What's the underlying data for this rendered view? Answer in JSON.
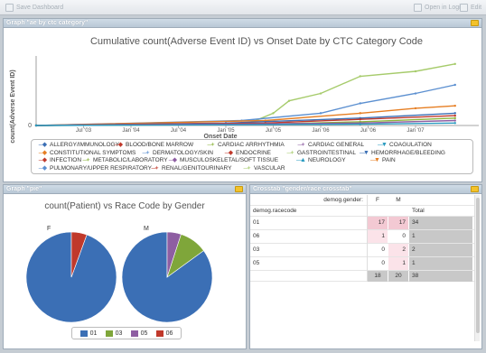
{
  "toolbar": {
    "save_dashboard": "Save Dashboard",
    "open_in_logic": "Open in Logic",
    "edit": "Edit"
  },
  "line_panel": {
    "title": "Graph \"ae by ctc category\"",
    "chart_title": "Cumulative count(Adverse Event ID) vs Onset Date by CTC Category Code",
    "ylabel": "count(Adverse Event ID)",
    "xlabel": "Onset Date"
  },
  "legend": [
    {
      "label": "ALLERGY/IMMUNOLOGY",
      "color": "#3b6fb5",
      "marker": "◆"
    },
    {
      "label": "BLOOD/BONE MARROW",
      "color": "#c0392b",
      "marker": "◆"
    },
    {
      "label": "CARDIAC ARRHYTHMIA",
      "color": "#8bb43a",
      "marker": "+"
    },
    {
      "label": "CARDIAC GENERAL",
      "color": "#8e5ea2",
      "marker": "+"
    },
    {
      "label": "COAGULATION",
      "color": "#2a9bc0",
      "marker": "▼"
    },
    {
      "label": "CONSTITUTIONAL SYMPTOMS",
      "color": "#e67e22",
      "marker": "◆"
    },
    {
      "label": "DERMATOLOGY/SKIN",
      "color": "#5b8fd0",
      "marker": "+"
    },
    {
      "label": "ENDOCRINE",
      "color": "#c0392b",
      "marker": "◆"
    },
    {
      "label": "GASTROINTESTINAL",
      "color": "#a6cb6b",
      "marker": "+"
    },
    {
      "label": "HEMORRHAGE/BLEEDING",
      "color": "#3b6fb5",
      "marker": "▼"
    },
    {
      "label": "INFECTION",
      "color": "#c0392b",
      "marker": "◆"
    },
    {
      "label": "METABOLIC/LABORATORY",
      "color": "#8bb43a",
      "marker": "+"
    },
    {
      "label": "MUSCULOSKELETAL/SOFT TISSUE",
      "color": "#8e5ea2",
      "marker": "◆"
    },
    {
      "label": "NEUROLOGY",
      "color": "#2a9bc0",
      "marker": "▲"
    },
    {
      "label": "PAIN",
      "color": "#e67e22",
      "marker": "▼"
    },
    {
      "label": "PULMONARY/UPPER RESPIRATORY",
      "color": "#5b8fd0",
      "marker": "◆"
    },
    {
      "label": "RENAL/GENITOURINARY",
      "color": "#c0392b",
      "marker": "+"
    },
    {
      "label": "VASCULAR",
      "color": "#a6cb6b",
      "marker": "+"
    }
  ],
  "pie_panel": {
    "title": "Graph \"pie\"",
    "chart_title": "count(Patient) vs Race Code by Gender",
    "pie_f_label": "F",
    "pie_m_label": "M",
    "legend": [
      {
        "label": "01",
        "color": "#3b6fb5"
      },
      {
        "label": "03",
        "color": "#7fa63a"
      },
      {
        "label": "05",
        "color": "#8e5ea2"
      },
      {
        "label": "06",
        "color": "#c0392b"
      }
    ]
  },
  "crosstab": {
    "title": "Crosstab \"gender/race crosstab\"",
    "header_gender": "demog.gender:",
    "header_race": "demog.racecode",
    "col_f": "F",
    "col_m": "M",
    "col_total": "Total",
    "rows": [
      {
        "race": "01",
        "f": "17",
        "m": "17",
        "total": "34"
      },
      {
        "race": "06",
        "f": "1",
        "m": "0",
        "total": "1"
      },
      {
        "race": "03",
        "f": "0",
        "m": "2",
        "total": "2"
      },
      {
        "race": "05",
        "f": "0",
        "m": "1",
        "total": "1"
      }
    ],
    "totals": {
      "f": "18",
      "m": "20",
      "total": "38"
    }
  },
  "chart_data": [
    {
      "type": "line",
      "title": "Cumulative count(Adverse Event ID) vs Onset Date by CTC Category Code",
      "xlabel": "Onset Date",
      "ylabel": "count(Adverse Event ID)",
      "x_ticks": [
        "Jul '03",
        "Jan '04",
        "Jul '04",
        "Jan '05",
        "Jul '05",
        "Jan '06",
        "Jul '06",
        "Jan '07"
      ],
      "y_ticks": [
        "0"
      ],
      "series": [
        {
          "name": "VASCULAR",
          "color": "#a6cb6b",
          "points": [
            [
              "Jan '03",
              0
            ],
            [
              "Apr '05",
              2
            ],
            [
              "Jul '05",
              10
            ],
            [
              "Sep '05",
              20
            ],
            [
              "Jan '06",
              26
            ],
            [
              "Jun '06",
              40
            ],
            [
              "Jan '07",
              44
            ],
            [
              "Jun '07",
              50
            ]
          ]
        },
        {
          "name": "DERMATOLOGY/SKIN",
          "color": "#5b8fd0",
          "points": [
            [
              "Jan '03",
              0
            ],
            [
              "Mar '05",
              4
            ],
            [
              "Jan '06",
              10
            ],
            [
              "Jun '06",
              18
            ],
            [
              "Jan '07",
              26
            ],
            [
              "Jun '07",
              33
            ]
          ]
        },
        {
          "name": "CONSTITUTIONAL SYMPTOMS",
          "color": "#e67e22",
          "points": [
            [
              "Jan '03",
              0
            ],
            [
              "Jun '05",
              4
            ],
            [
              "Jun '06",
              10
            ],
            [
              "Jan '07",
              14
            ],
            [
              "Jun '07",
              16
            ]
          ]
        },
        {
          "name": "ALLERGY/IMMUNOLOGY",
          "color": "#3b6fb5",
          "points": [
            [
              "Jan '03",
              0
            ],
            [
              "Jan '05",
              2
            ],
            [
              "Jun '06",
              6
            ],
            [
              "Jun '07",
              10
            ]
          ]
        },
        {
          "name": "INFECTION",
          "color": "#c0392b",
          "points": [
            [
              "Jan '03",
              0
            ],
            [
              "Jun '05",
              2
            ],
            [
              "Jun '06",
              5
            ],
            [
              "Jun '07",
              8
            ]
          ]
        },
        {
          "name": "METABOLIC/LABORATORY",
          "color": "#8bb43a",
          "points": [
            [
              "Jan '03",
              0
            ],
            [
              "Jun '05",
              1
            ],
            [
              "Jun '06",
              3
            ],
            [
              "Jun '07",
              6
            ]
          ]
        },
        {
          "name": "MUSCULOSKELETAL/SOFT TISSUE",
          "color": "#8e5ea2",
          "points": [
            [
              "Jan '03",
              0
            ],
            [
              "Jun '06",
              2
            ],
            [
              "Jun '07",
              4
            ]
          ]
        },
        {
          "name": "NEUROLOGY",
          "color": "#2a9bc0",
          "points": [
            [
              "Jan '03",
              0
            ],
            [
              "Jun '06",
              1
            ],
            [
              "Jun '07",
              2
            ]
          ]
        }
      ],
      "grid": false,
      "legend_position": "bottom"
    },
    {
      "type": "pie",
      "title": "count(Patient) vs Race Code by Gender",
      "pies": [
        {
          "name": "F",
          "slices": [
            {
              "label": "01",
              "value": 17
            },
            {
              "label": "06",
              "value": 1
            }
          ]
        },
        {
          "name": "M",
          "slices": [
            {
              "label": "01",
              "value": 17
            },
            {
              "label": "03",
              "value": 2
            },
            {
              "label": "05",
              "value": 1
            }
          ]
        }
      ],
      "legend_position": "bottom"
    }
  ]
}
